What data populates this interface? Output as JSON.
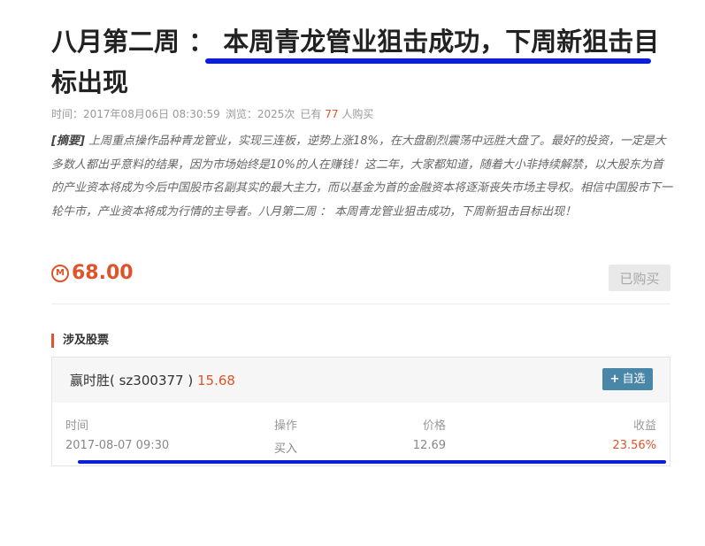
{
  "article": {
    "title": "八月第二周 ： 本周青龙管业狙击成功，下周新狙击目标出现",
    "meta": {
      "time_label": "时间：",
      "time": "2017年08月06日 08:30:59",
      "views_label": "浏览：",
      "views": "2025次",
      "bought_prefix": "已有",
      "bought_count": "77",
      "bought_suffix": "人购买"
    },
    "summary_tag": "[摘要]",
    "summary": "上周重点操作品种青龙管业，实现三连板，逆势上涨18%，在大盘剧烈震荡中远胜大盘了。最好的投资，一定是大多数人都出乎意料的结果，因为市场始终是10%的人在赚钱！这二年，大家都知道，随着大小非持续解禁，以大股东为首的产业资本将成为今后中国股市名副其实的最大主力，而以基金为首的金融资本将逐渐丧失市场主导权。相信中国股市下一轮牛市，产业资本将成为行情的主导者。八月第二周 ： 本周青龙管业狙击成功，下周新狙击目标出现！",
    "price": "68.00",
    "coin_symbol": "M",
    "buy_button": "已购买"
  },
  "stocks": {
    "section_title": "涉及股票",
    "name": "赢时胜( sz300377 )",
    "current_price": "15.68",
    "watch_button_icon": "+",
    "watch_button": "自选",
    "columns": [
      "时间",
      "操作",
      "价格",
      "收益"
    ],
    "trades": [
      {
        "time": "2017-08-07 09:30",
        "action": "买入",
        "price": "12.69",
        "profit": "23.56%"
      }
    ]
  },
  "colors": {
    "accent": "#e0532a",
    "annotation_underline": "#0b1fd8",
    "watch_button_bg": "#4a86a8"
  }
}
